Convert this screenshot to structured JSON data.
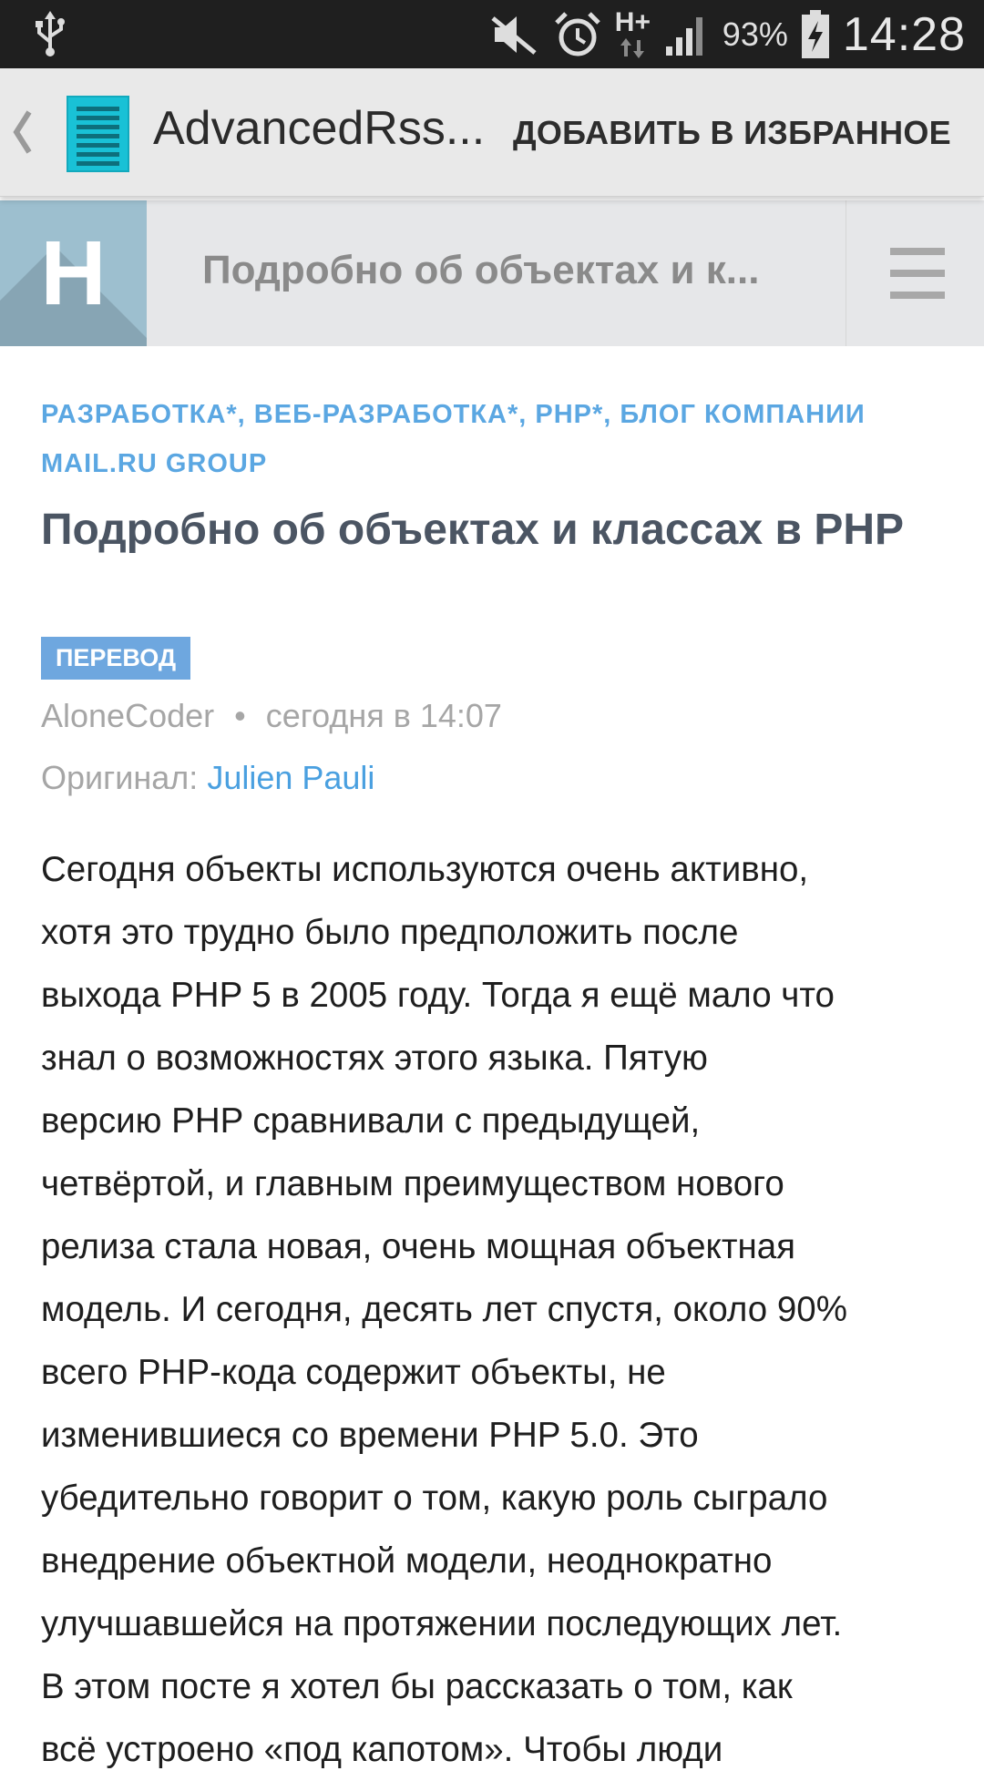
{
  "status_bar": {
    "icons": [
      "usb-icon",
      "mute-icon",
      "alarm-icon",
      "hplus-data-icon",
      "signal-icon",
      "battery-charging-icon"
    ],
    "network_label": "H+",
    "battery": "93%",
    "time": "14:28"
  },
  "action_bar": {
    "title": "AdvancedRss...",
    "favorite_button": "ДОБАВИТЬ В ИЗБРАННОЕ"
  },
  "habr_header": {
    "logo_letter": "H",
    "title": "Подробно об объектах и к..."
  },
  "article": {
    "hubs_line1": "РАЗРАБОТКА*, ВЕБ-РАЗРАБОТКА*, PHP*, БЛОГ КОМПАНИИ",
    "hubs_line2": "MAIL.RU GROUP",
    "title": "Подробно об объектах и классах в PHP",
    "badge": "ПЕРЕВОД",
    "author": "AloneCoder",
    "separator": "•",
    "date": "сегодня в 14:07",
    "original_label": "Оригинал:",
    "original_author": "Julien Pauli",
    "body_lines": [
      "Сегодня объекты используются очень активно,",
      "хотя это трудно было предположить после",
      "выхода PHP 5 в 2005 году. Тогда я ещё мало что",
      "знал о возможностях этого языка. Пятую",
      "версию PHP сравнивали с предыдущей,",
      "четвёртой, и главным преимуществом нового",
      "релиза стала новая, очень мощная объектная",
      "модель. И сегодня, десять лет спустя, около 90%",
      "всего PHP-кода содержит объекты, не",
      "изменившиеся со времени PHP 5.0. Это",
      "убедительно говорит о том, какую роль сыграло",
      "внедрение объектной модели, неоднократно",
      "улучшавшейся на протяжении последующих лет.",
      "В этом посте я хотел бы рассказать о том, как",
      "всё устроено «под капотом». Чтобы люди"
    ]
  }
}
